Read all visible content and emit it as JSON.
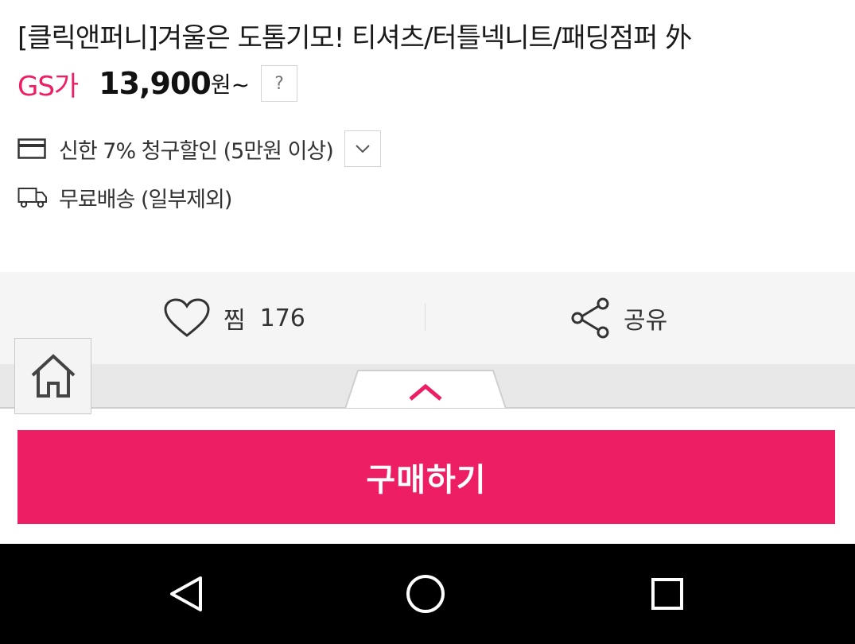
{
  "product": {
    "title": "[클릭앤퍼니]겨울은 도톰기모! 티셔츠/터틀넥니트/패딩점퍼 外",
    "price_label": "GS가",
    "price_value": "13,900",
    "price_unit": "원~",
    "help_label": "?"
  },
  "benefits": {
    "card_discount": "신한 7% 청구할인 (5만원 이상)",
    "shipping": "무료배송 (일부제외)"
  },
  "actions": {
    "wish_label": "찜",
    "wish_count": "176",
    "share_label": "공유"
  },
  "buy": {
    "label": "구매하기"
  },
  "colors": {
    "accent": "#ed1e63",
    "nav_bg": "#000000",
    "action_bg": "#f5f5f5"
  },
  "icons": {
    "card": "credit-card-icon",
    "ship": "truck-icon",
    "wish": "heart-icon",
    "share": "share-icon",
    "home": "home-icon",
    "expand": "chevron-up-icon",
    "dropdown": "chevron-down-icon",
    "nav": [
      "back-triangle-icon",
      "home-circle-icon",
      "recents-square-icon"
    ]
  }
}
